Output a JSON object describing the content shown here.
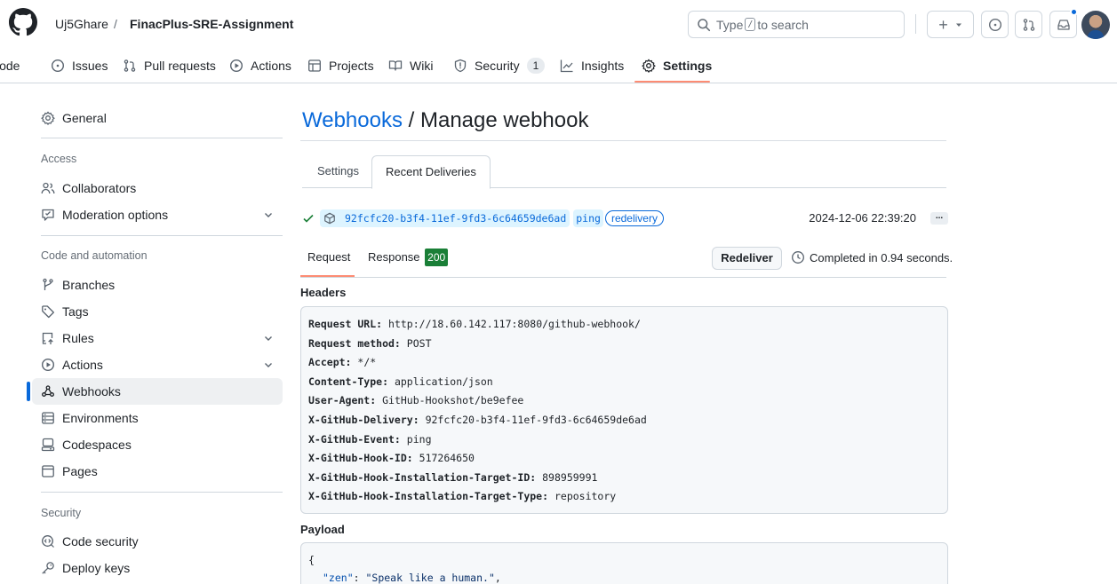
{
  "header": {
    "owner": "Uj5Ghare",
    "separator": "/",
    "repo": "FinacPlus-SRE-Assignment",
    "search_prefix": "Type",
    "search_key": "/",
    "search_suffix": "to search",
    "plus_label": "+"
  },
  "repo_nav": {
    "code": "Code",
    "issues": "Issues",
    "pull_requests": "Pull requests",
    "actions": "Actions",
    "projects": "Projects",
    "wiki": "Wiki",
    "security": "Security",
    "security_count": "1",
    "insights": "Insights",
    "settings": "Settings"
  },
  "sidebar": {
    "general": "General",
    "access_heading": "Access",
    "collaborators": "Collaborators",
    "moderation": "Moderation options",
    "code_automation_heading": "Code and automation",
    "branches": "Branches",
    "tags": "Tags",
    "rules": "Rules",
    "actions": "Actions",
    "webhooks": "Webhooks",
    "environments": "Environments",
    "codespaces": "Codespaces",
    "pages": "Pages",
    "security_heading": "Security",
    "code_security": "Code security",
    "deploy_keys": "Deploy keys"
  },
  "main": {
    "breadcrumb_link": "Webhooks",
    "breadcrumb_sep": " / ",
    "title": "Manage webhook",
    "tabs": {
      "settings": "Settings",
      "recent": "Recent Deliveries"
    },
    "delivery": {
      "guid": "92fcfc20-b3f4-11ef-9fd3-6c64659de6ad",
      "event": "ping",
      "redelivery_label": "redelivery",
      "timestamp": "2024-12-06 22:39:20",
      "more": "..."
    },
    "request_tab": "Request",
    "response_tab": "Response",
    "response_status": "200",
    "redeliver_button": "Redeliver",
    "completed_text": "Completed in 0.94 seconds.",
    "headers_label": "Headers",
    "headers": [
      {
        "key": "Request URL:",
        "value": "http://18.60.142.117:8080/github-webhook/"
      },
      {
        "key": "Request method:",
        "value": "POST"
      },
      {
        "key": "Accept:",
        "value": "*/*"
      },
      {
        "key": "Content-Type:",
        "value": "application/json"
      },
      {
        "key": "User-Agent:",
        "value": "GitHub-Hookshot/be9efee"
      },
      {
        "key": "X-GitHub-Delivery:",
        "value": "92fcfc20-b3f4-11ef-9fd3-6c64659de6ad"
      },
      {
        "key": "X-GitHub-Event:",
        "value": "ping"
      },
      {
        "key": "X-GitHub-Hook-ID:",
        "value": "517264650"
      },
      {
        "key": "X-GitHub-Hook-Installation-Target-ID:",
        "value": "898959991"
      },
      {
        "key": "X-GitHub-Hook-Installation-Target-Type:",
        "value": "repository"
      }
    ],
    "payload_label": "Payload",
    "payload": {
      "open_brace": "{",
      "zen_key": "\"zen\"",
      "zen_colon": ": ",
      "zen_value": "\"Speak like a human.\"",
      "zen_comma": ","
    }
  },
  "colors": {
    "accent": "#0969da",
    "success": "#1a7f37",
    "selected_underline": "#fd8c73"
  }
}
